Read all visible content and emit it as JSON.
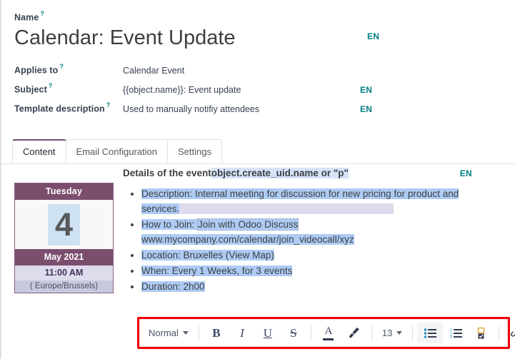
{
  "form": {
    "name_label": "Name",
    "title": "Calendar: Event Update",
    "title_lang": "EN",
    "rows": [
      {
        "label": "Applies to",
        "value": "Calendar Event",
        "lang": ""
      },
      {
        "label": "Subject",
        "value": "{{object.name}}: Event update",
        "lang": "EN"
      },
      {
        "label": "Template description",
        "value": "Used to manually notifiy attendees",
        "lang": "EN"
      }
    ],
    "help_mark": "?"
  },
  "tabs": [
    {
      "label": "Content",
      "active": true
    },
    {
      "label": "Email Configuration",
      "active": false
    },
    {
      "label": "Settings",
      "active": false
    }
  ],
  "calendar": {
    "weekday": "Tuesday",
    "day": "4",
    "month": "May 2021",
    "time": "11:00 AM",
    "timezone": "( Europe/Brussels)"
  },
  "content": {
    "lang": "EN",
    "heading_plain": "Details of the event",
    "heading_field": "object.create_uid.name or \"p\"",
    "items": [
      {
        "prefix": "Description: ",
        "body": "Internal meeting for discussion for new pricing for product and services."
      },
      {
        "prefix": "How to Join: ",
        "body": "Join with Odoo Discuss",
        "link": "www.mycompany.com/calendar/join_videocall/xyz"
      },
      {
        "prefix": "Location: ",
        "body": "Bruxelles (View Map)"
      },
      {
        "prefix": "When: ",
        "body": "Every 1 Weeks, for 3 events"
      },
      {
        "prefix": "Duration: ",
        "body": "2h00"
      }
    ]
  },
  "toolbar": {
    "style_value": "Normal",
    "font_size_value": "13",
    "buttons": [
      {
        "name": "bold",
        "glyph": "B"
      },
      {
        "name": "italic",
        "glyph": "I"
      },
      {
        "name": "underline",
        "glyph": "U"
      },
      {
        "name": "strikethrough",
        "glyph": "S"
      },
      {
        "name": "font-color",
        "glyph": "A"
      },
      {
        "name": "background-color",
        "glyph": "brush"
      },
      {
        "name": "bulleted-list",
        "glyph": "list-ul"
      },
      {
        "name": "numbered-list",
        "glyph": "list-ol"
      },
      {
        "name": "checklist",
        "glyph": "list-check"
      },
      {
        "name": "unlink",
        "glyph": "chain-broken"
      },
      {
        "name": "code-view",
        "glyph": "</>"
      }
    ],
    "code_label": "</>"
  },
  "colors": {
    "accent": "#714b67",
    "link": "#017e84",
    "selection": "#aecbf4",
    "highlight_box": "#f5000b",
    "calendar_header": "#7b4e6e"
  }
}
